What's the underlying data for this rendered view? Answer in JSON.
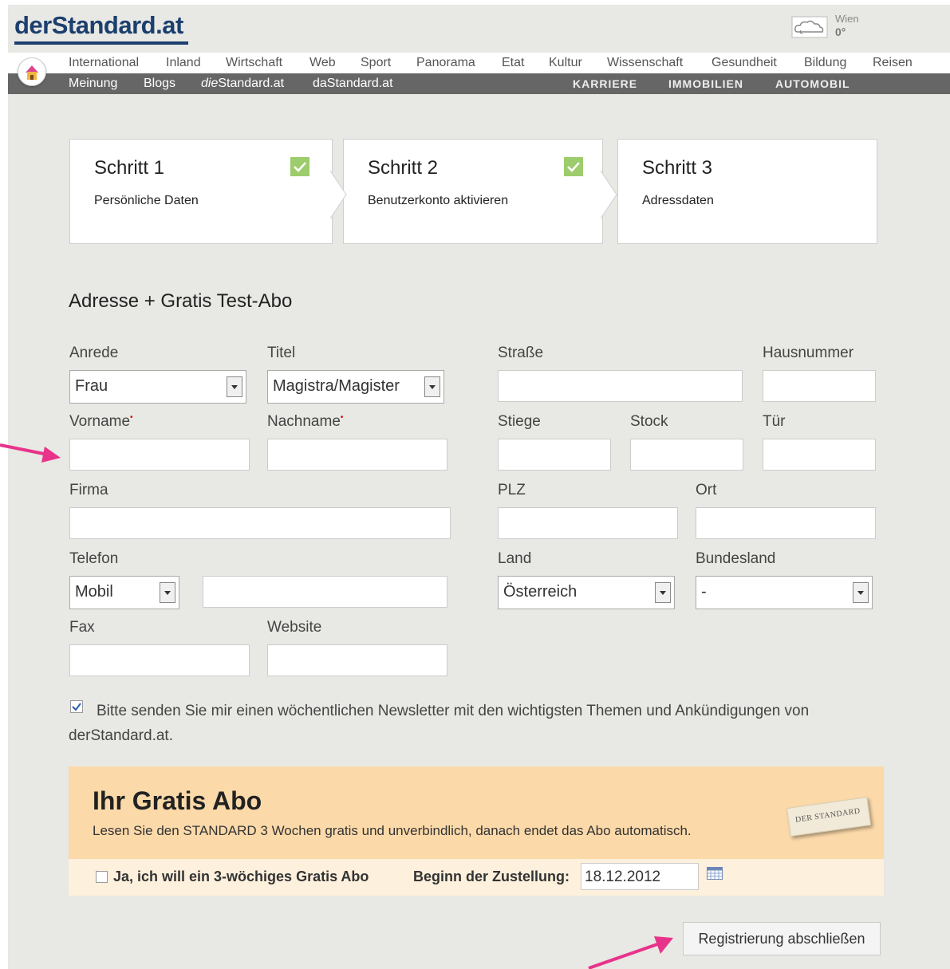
{
  "header": {
    "logo": "derStandard.at",
    "weather": {
      "city": "Wien",
      "temp": "0°",
      "icon": "cloud-icon"
    }
  },
  "nav": {
    "primary": [
      "International",
      "Inland",
      "Wirtschaft",
      "Web",
      "Sport",
      "Panorama",
      "Etat",
      "Kultur",
      "Wissenschaft",
      "Gesundheit",
      "Bildung",
      "Reisen"
    ],
    "secondary": {
      "meinung": "Meinung",
      "blogs": "Blogs",
      "diestandard_prefix": "die",
      "diestandard_suffix": "Standard.at",
      "dastandard": "daStandard.at",
      "karriere": "KARRIERE",
      "immobilien": "IMMOBILIEN",
      "automobil": "AUTOMOBIL"
    }
  },
  "steps": [
    {
      "title": "Schritt 1",
      "subtitle": "Persönliche Daten",
      "done": true
    },
    {
      "title": "Schritt 2",
      "subtitle": "Benutzerkonto aktivieren",
      "done": true
    },
    {
      "title": "Schritt 3",
      "subtitle": "Adressdaten",
      "done": false
    }
  ],
  "form": {
    "section_title": "Adresse + Gratis Test-Abo",
    "labels": {
      "anrede": "Anrede",
      "titel": "Titel",
      "strasse": "Straße",
      "hausnummer": "Hausnummer",
      "vorname": "Vorname",
      "nachname": "Nachname",
      "stiege": "Stiege",
      "stock": "Stock",
      "tuer": "Tür",
      "firma": "Firma",
      "plz": "PLZ",
      "ort": "Ort",
      "telefon": "Telefon",
      "land": "Land",
      "bundesland": "Bundesland",
      "fax": "Fax",
      "website": "Website"
    },
    "values": {
      "anrede": "Frau",
      "titel": "Magistra/Magister",
      "telefon_type": "Mobil",
      "land": "Österreich",
      "bundesland": "-"
    },
    "newsletter": {
      "checked": true,
      "text": "Bitte senden Sie mir einen wöchentlichen Newsletter mit den wichtigsten Themen und Ankündigungen von derStandard.at."
    }
  },
  "abo": {
    "title": "Ihr Gratis Abo",
    "text": "Lesen Sie den STANDARD 3 Wochen gratis und unverbindlich, danach endet das Abo automatisch.",
    "stamp": "DER STANDARD",
    "checkbox_label": "Ja, ich will ein 3-wöchiges Gratis Abo",
    "checkbox_checked": false,
    "beginn_label": "Beginn der Zustellung:",
    "beginn_value": "18.12.2012"
  },
  "submit_label": "Registrierung abschließen",
  "colors": {
    "logo": "#1b3f6e",
    "nav_dark": "#666666",
    "abo_bg": "#fbd9a9",
    "check": "#9ccc6b",
    "annotation_arrow": "#e8338a"
  }
}
